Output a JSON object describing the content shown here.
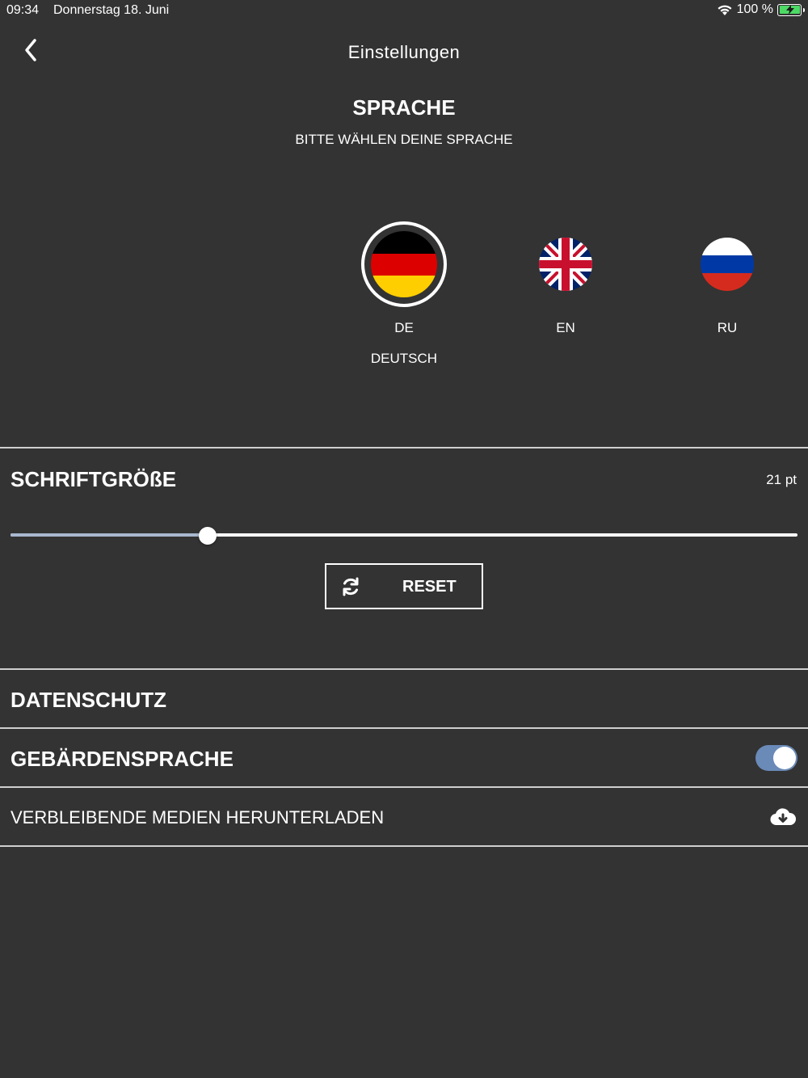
{
  "status_bar": {
    "time": "09:34",
    "date": "Donnerstag 18. Juni",
    "battery": "100 %"
  },
  "nav": {
    "back_icon": "chevron-left-icon",
    "title": "Einstellungen"
  },
  "language": {
    "title": "SPRACHE",
    "subtitle": "BITTE WÄHLEN DEINE SPRACHE",
    "options": [
      {
        "code": "DE",
        "name": "DEUTSCH",
        "selected": true,
        "flag": "german-flag-icon"
      },
      {
        "code": "EN",
        "name": "",
        "selected": false,
        "flag": "uk-flag-icon"
      },
      {
        "code": "RU",
        "name": "",
        "selected": false,
        "flag": "russian-flag-icon"
      }
    ]
  },
  "font_size": {
    "title": "SCHRIFTGRÖßE",
    "value": "21 pt",
    "slider_fraction": 0.25,
    "reset_label": "RESET"
  },
  "rows": {
    "privacy": "DATENSCHUTZ",
    "sign_language": "GEBÄRDENSPRACHE",
    "sign_language_enabled": true,
    "download": "VERBLEIBENDE MEDIEN HERUNTERLADEN"
  },
  "colors": {
    "background": "#333333",
    "accent": "#6a8ab8",
    "slider_fill": "#a8b8cf"
  }
}
